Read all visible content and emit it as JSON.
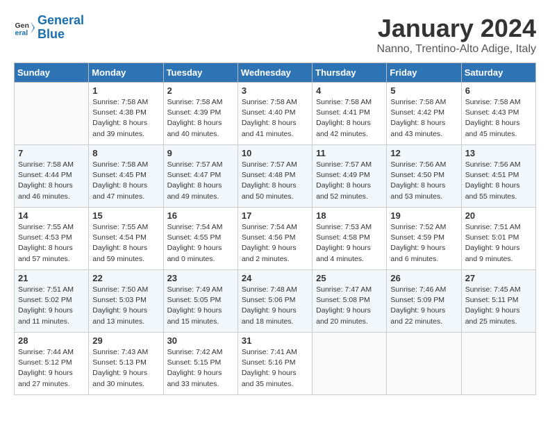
{
  "header": {
    "logo_line1": "General",
    "logo_line2": "Blue",
    "month": "January 2024",
    "location": "Nanno, Trentino-Alto Adige, Italy"
  },
  "days_of_week": [
    "Sunday",
    "Monday",
    "Tuesday",
    "Wednesday",
    "Thursday",
    "Friday",
    "Saturday"
  ],
  "weeks": [
    [
      {
        "day": "",
        "info": ""
      },
      {
        "day": "1",
        "info": "Sunrise: 7:58 AM\nSunset: 4:38 PM\nDaylight: 8 hours\nand 39 minutes."
      },
      {
        "day": "2",
        "info": "Sunrise: 7:58 AM\nSunset: 4:39 PM\nDaylight: 8 hours\nand 40 minutes."
      },
      {
        "day": "3",
        "info": "Sunrise: 7:58 AM\nSunset: 4:40 PM\nDaylight: 8 hours\nand 41 minutes."
      },
      {
        "day": "4",
        "info": "Sunrise: 7:58 AM\nSunset: 4:41 PM\nDaylight: 8 hours\nand 42 minutes."
      },
      {
        "day": "5",
        "info": "Sunrise: 7:58 AM\nSunset: 4:42 PM\nDaylight: 8 hours\nand 43 minutes."
      },
      {
        "day": "6",
        "info": "Sunrise: 7:58 AM\nSunset: 4:43 PM\nDaylight: 8 hours\nand 45 minutes."
      }
    ],
    [
      {
        "day": "7",
        "info": "Sunrise: 7:58 AM\nSunset: 4:44 PM\nDaylight: 8 hours\nand 46 minutes."
      },
      {
        "day": "8",
        "info": "Sunrise: 7:58 AM\nSunset: 4:45 PM\nDaylight: 8 hours\nand 47 minutes."
      },
      {
        "day": "9",
        "info": "Sunrise: 7:57 AM\nSunset: 4:47 PM\nDaylight: 8 hours\nand 49 minutes."
      },
      {
        "day": "10",
        "info": "Sunrise: 7:57 AM\nSunset: 4:48 PM\nDaylight: 8 hours\nand 50 minutes."
      },
      {
        "day": "11",
        "info": "Sunrise: 7:57 AM\nSunset: 4:49 PM\nDaylight: 8 hours\nand 52 minutes."
      },
      {
        "day": "12",
        "info": "Sunrise: 7:56 AM\nSunset: 4:50 PM\nDaylight: 8 hours\nand 53 minutes."
      },
      {
        "day": "13",
        "info": "Sunrise: 7:56 AM\nSunset: 4:51 PM\nDaylight: 8 hours\nand 55 minutes."
      }
    ],
    [
      {
        "day": "14",
        "info": "Sunrise: 7:55 AM\nSunset: 4:53 PM\nDaylight: 8 hours\nand 57 minutes."
      },
      {
        "day": "15",
        "info": "Sunrise: 7:55 AM\nSunset: 4:54 PM\nDaylight: 8 hours\nand 59 minutes."
      },
      {
        "day": "16",
        "info": "Sunrise: 7:54 AM\nSunset: 4:55 PM\nDaylight: 9 hours\nand 0 minutes."
      },
      {
        "day": "17",
        "info": "Sunrise: 7:54 AM\nSunset: 4:56 PM\nDaylight: 9 hours\nand 2 minutes."
      },
      {
        "day": "18",
        "info": "Sunrise: 7:53 AM\nSunset: 4:58 PM\nDaylight: 9 hours\nand 4 minutes."
      },
      {
        "day": "19",
        "info": "Sunrise: 7:52 AM\nSunset: 4:59 PM\nDaylight: 9 hours\nand 6 minutes."
      },
      {
        "day": "20",
        "info": "Sunrise: 7:51 AM\nSunset: 5:01 PM\nDaylight: 9 hours\nand 9 minutes."
      }
    ],
    [
      {
        "day": "21",
        "info": "Sunrise: 7:51 AM\nSunset: 5:02 PM\nDaylight: 9 hours\nand 11 minutes."
      },
      {
        "day": "22",
        "info": "Sunrise: 7:50 AM\nSunset: 5:03 PM\nDaylight: 9 hours\nand 13 minutes."
      },
      {
        "day": "23",
        "info": "Sunrise: 7:49 AM\nSunset: 5:05 PM\nDaylight: 9 hours\nand 15 minutes."
      },
      {
        "day": "24",
        "info": "Sunrise: 7:48 AM\nSunset: 5:06 PM\nDaylight: 9 hours\nand 18 minutes."
      },
      {
        "day": "25",
        "info": "Sunrise: 7:47 AM\nSunset: 5:08 PM\nDaylight: 9 hours\nand 20 minutes."
      },
      {
        "day": "26",
        "info": "Sunrise: 7:46 AM\nSunset: 5:09 PM\nDaylight: 9 hours\nand 22 minutes."
      },
      {
        "day": "27",
        "info": "Sunrise: 7:45 AM\nSunset: 5:11 PM\nDaylight: 9 hours\nand 25 minutes."
      }
    ],
    [
      {
        "day": "28",
        "info": "Sunrise: 7:44 AM\nSunset: 5:12 PM\nDaylight: 9 hours\nand 27 minutes."
      },
      {
        "day": "29",
        "info": "Sunrise: 7:43 AM\nSunset: 5:13 PM\nDaylight: 9 hours\nand 30 minutes."
      },
      {
        "day": "30",
        "info": "Sunrise: 7:42 AM\nSunset: 5:15 PM\nDaylight: 9 hours\nand 33 minutes."
      },
      {
        "day": "31",
        "info": "Sunrise: 7:41 AM\nSunset: 5:16 PM\nDaylight: 9 hours\nand 35 minutes."
      },
      {
        "day": "",
        "info": ""
      },
      {
        "day": "",
        "info": ""
      },
      {
        "day": "",
        "info": ""
      }
    ]
  ]
}
